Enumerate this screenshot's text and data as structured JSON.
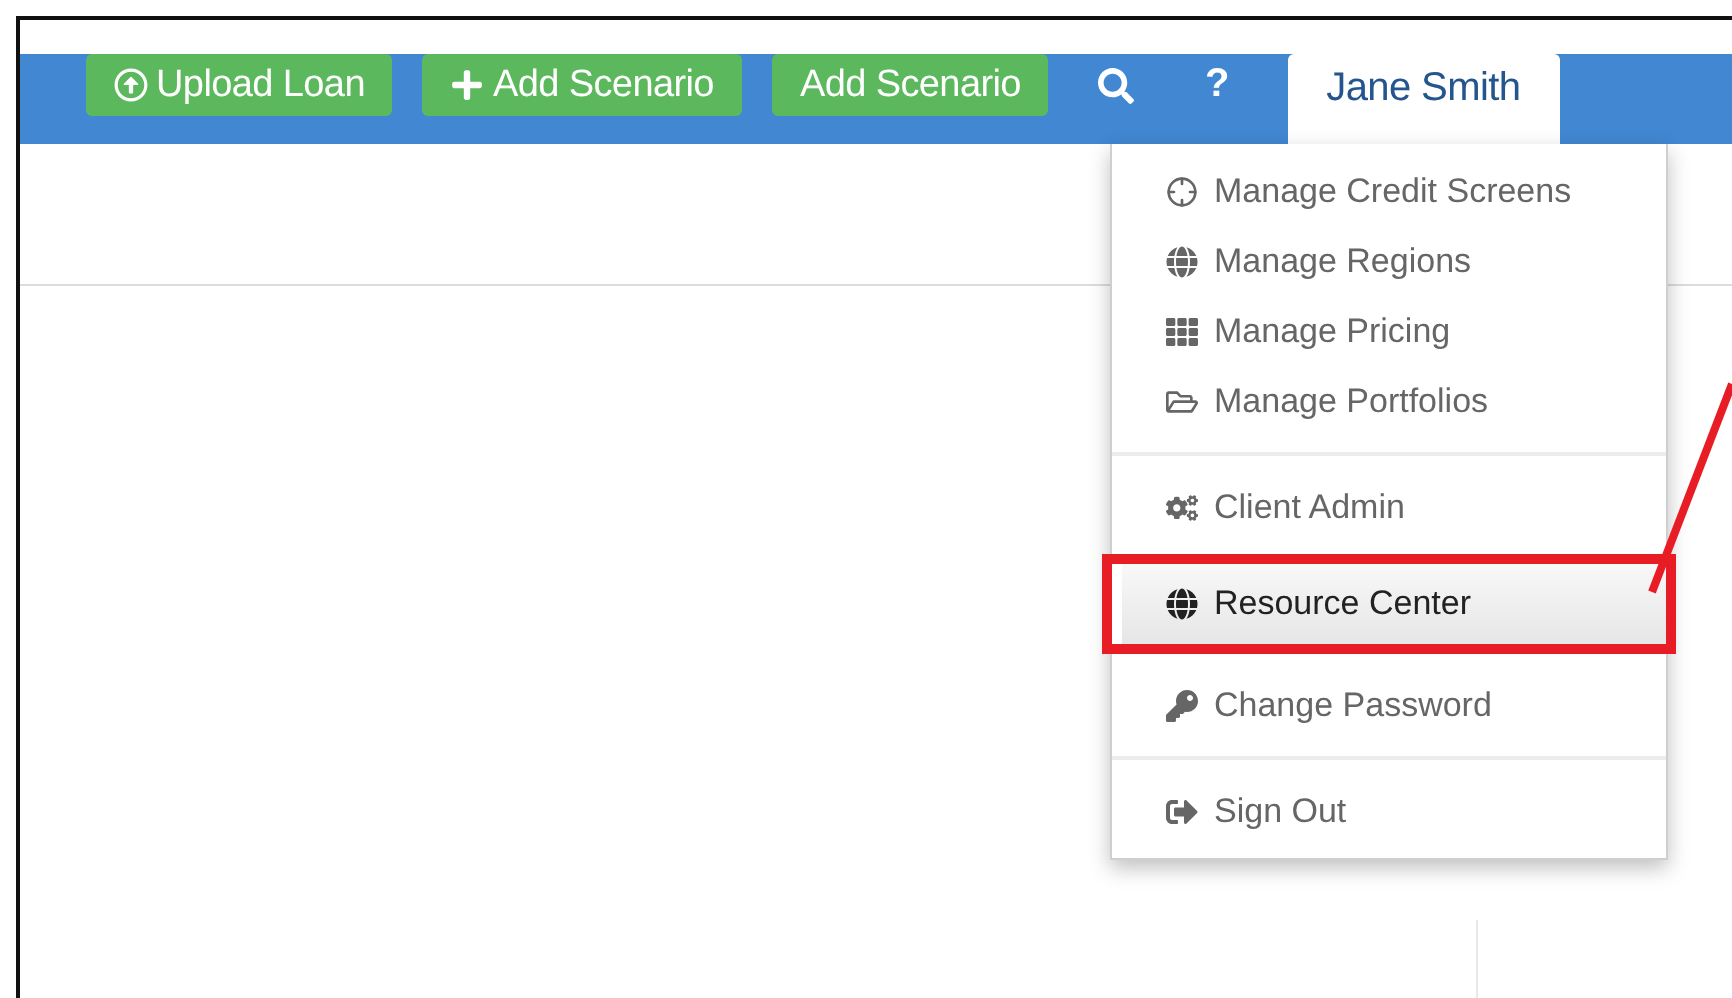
{
  "toolbar": {
    "buttons": [
      {
        "label": "Upload Loan",
        "kind": "upload"
      },
      {
        "label": "Add Scenario",
        "kind": "add"
      },
      {
        "label": "Add Scenario",
        "kind": "plain"
      }
    ],
    "help": "?",
    "user": {
      "label": "Jane Smith",
      "expanded": true
    }
  },
  "user_menu": {
    "groups": [
      {
        "items": [
          {
            "label": "Manage Credit Screens",
            "selected": false
          },
          {
            "label": "Manage Regions",
            "selected": false
          },
          {
            "label": "Manage Pricing",
            "selected": false
          },
          {
            "label": "Manage Portfolios",
            "selected": false
          }
        ]
      },
      {
        "items": [
          {
            "label": "Client Admin",
            "selected": false
          }
        ]
      },
      {
        "items": [
          {
            "label": "Resource Center",
            "selected": true
          }
        ]
      },
      {
        "items": [
          {
            "label": "Change Password",
            "selected": false
          }
        ]
      },
      {
        "items": [
          {
            "label": "Sign Out",
            "selected": false
          }
        ]
      }
    ]
  }
}
